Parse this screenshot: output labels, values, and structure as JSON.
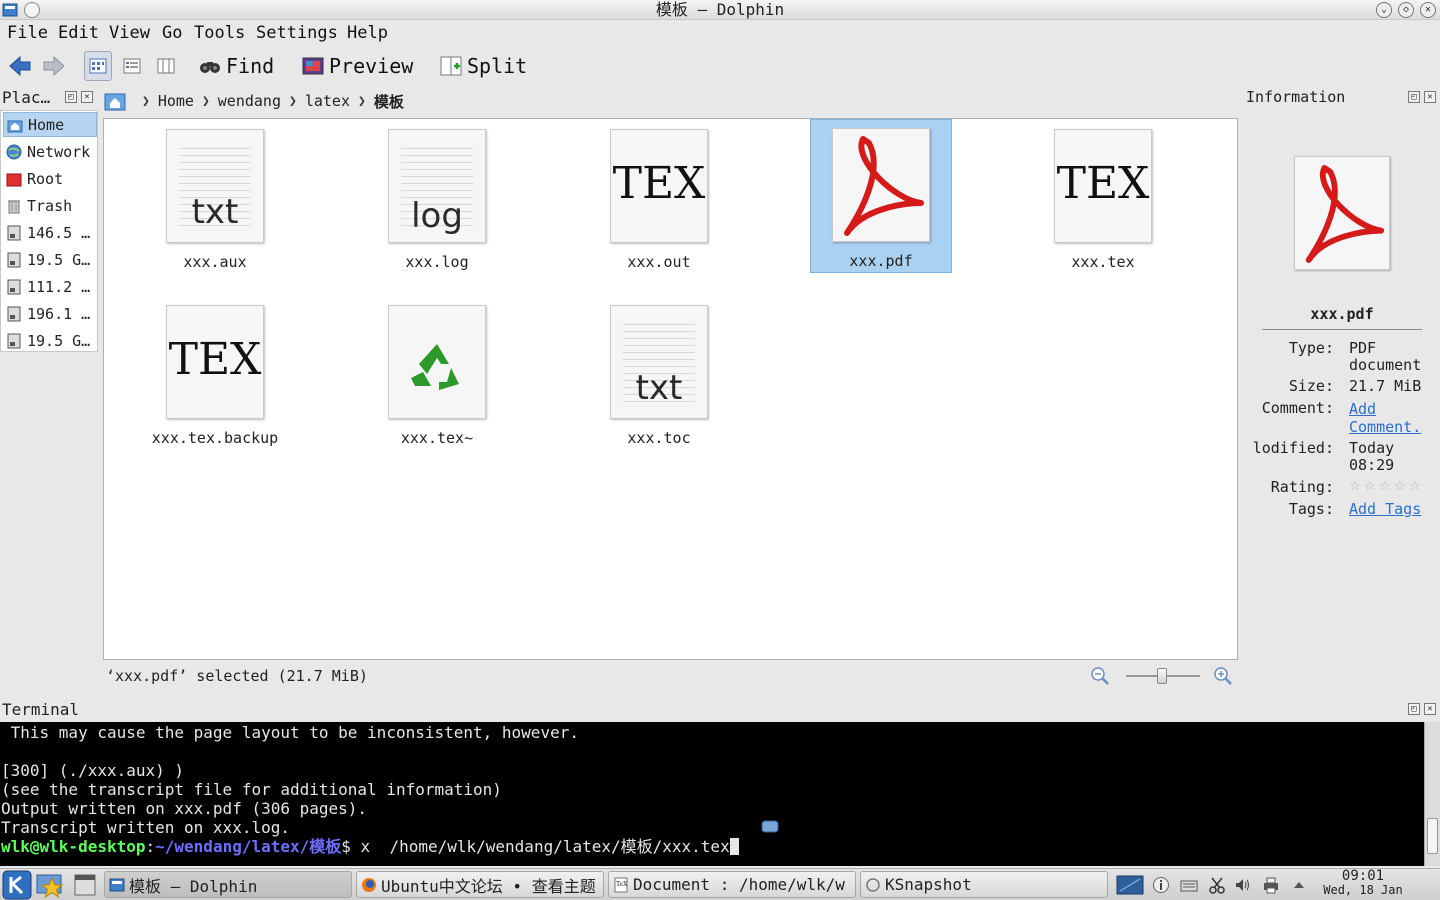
{
  "window": {
    "title": "模板 – Dolphin"
  },
  "menu": [
    "File",
    "Edit",
    "View",
    "Go",
    "Tools",
    "Settings",
    "Help"
  ],
  "toolbar": {
    "find": "Find",
    "preview": "Preview",
    "split": "Split"
  },
  "places": {
    "title": "Plac…",
    "items": [
      "Home",
      "Network",
      "Root",
      "Trash",
      "146.5 …",
      "19.5 G…",
      "111.2 …",
      "196.1 …",
      "19.5 G…"
    ]
  },
  "breadcrumb": [
    "Home",
    "wendang",
    "latex",
    "模板"
  ],
  "files": [
    {
      "name": "xxx.aux",
      "label": "txt",
      "kind": "text"
    },
    {
      "name": "xxx.log",
      "label": "log",
      "kind": "text"
    },
    {
      "name": "xxx.out",
      "label": "TEX",
      "kind": "tex"
    },
    {
      "name": "xxx.pdf",
      "label": "",
      "kind": "pdf",
      "selected": true
    },
    {
      "name": "xxx.tex",
      "label": "TEX",
      "kind": "tex"
    },
    {
      "name": "xxx.tex.backup",
      "label": "TEX",
      "kind": "tex"
    },
    {
      "name": "xxx.tex~",
      "label": "",
      "kind": "recycle"
    },
    {
      "name": "xxx.toc",
      "label": "txt",
      "kind": "text"
    }
  ],
  "status": {
    "text": "‘xxx.pdf’ selected (21.7 MiB)",
    "zoom_level": 0.45
  },
  "info": {
    "title": "Information",
    "filename": "xxx.pdf",
    "type_label": "Type:",
    "type_value": "PDF document",
    "size_label": "Size:",
    "size_value": "21.7 MiB",
    "comment_label": "Comment:",
    "comment_value": "Add Comment.",
    "modified_label": "lodified:",
    "modified_value": "Today 08:29",
    "rating_label": "Rating:",
    "rating_value": 0,
    "tags_label": "Tags:",
    "tags_value": "Add Tags"
  },
  "terminal": {
    "title": "Terminal",
    "lines": [
      " This may cause the page layout to be inconsistent, however.",
      "",
      "[300] (./xxx.aux) )",
      "(see the transcript file for additional information)",
      "Output written on xxx.pdf (306 pages).",
      "Transcript written on xxx.log."
    ],
    "prompt_user": "wlk@wlk-desktop",
    "prompt_sep": ":",
    "prompt_path": "~/wendang/latex/模板",
    "prompt_cmd": "$ x  /home/wlk/wendang/latex/模板/xxx.tex"
  },
  "taskbar": {
    "tasks": [
      "模板 – Dolphin",
      "Ubuntu中文论坛 • 查看主题",
      "Document : /home/wlk/w",
      "KSnapshot"
    ],
    "time": "09:01",
    "date": "Wed, 18 Jan"
  },
  "colors": {
    "selection": "#a9d1f2",
    "link": "#2a6fd0",
    "prompt_user": "#5cff5c",
    "prompt_path": "#6f6fff"
  }
}
